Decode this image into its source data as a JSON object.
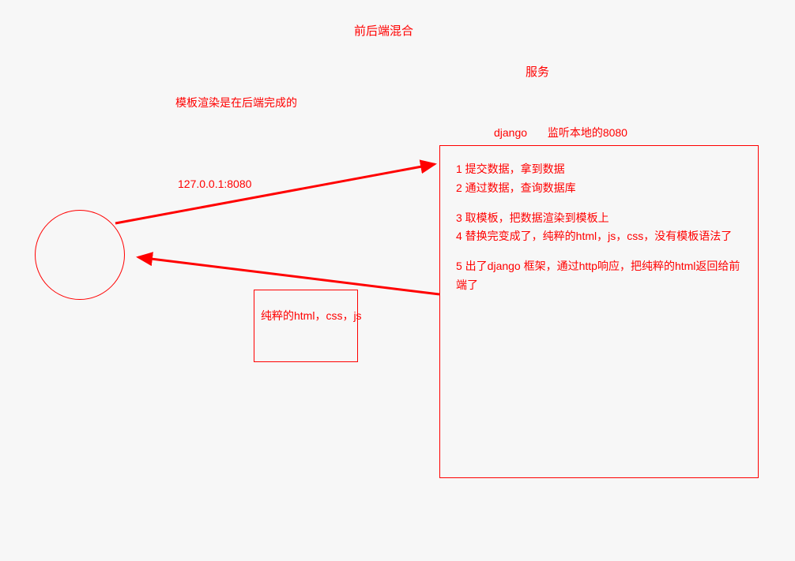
{
  "title": "前后端混合",
  "service_label": "服务",
  "template_render_note": "模板渲染是在后端完成的",
  "client_address": "127.0.0.1:8080",
  "pure_output_label": "纯粹的html，css，js",
  "django_label": "django",
  "listen_label": "监听本地的8080",
  "steps": {
    "s1": "1 提交数据，拿到数据",
    "s2": "2 通过数据，查询数据库",
    "s3": "3 取模板，把数据渲染到模板上",
    "s4": "4 替换完变成了，纯粹的html，js，css，没有模板语法了",
    "s5": "5 出了django 框架，通过http响应，把纯粹的html返回给前端了"
  },
  "colors": {
    "stroke": "#ff0000"
  }
}
